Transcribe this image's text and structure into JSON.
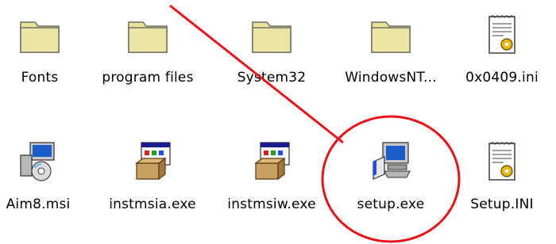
{
  "files": [
    {
      "name": "Fonts",
      "icon": "folder-icon"
    },
    {
      "name": "program files",
      "icon": "folder-icon"
    },
    {
      "name": "System32",
      "icon": "folder-icon"
    },
    {
      "name": "WindowsNT...",
      "icon": "folder-icon"
    },
    {
      "name": "0x0409.ini",
      "icon": "ini-file-icon"
    },
    {
      "name": "Aim8.msi",
      "icon": "msi-installer-icon"
    },
    {
      "name": "instmsia.exe",
      "icon": "installer-exe-icon"
    },
    {
      "name": "instmsiw.exe",
      "icon": "installer-exe-icon"
    },
    {
      "name": "setup.exe",
      "icon": "setup-exe-icon"
    },
    {
      "name": "Setup.INI",
      "icon": "ini-file-icon"
    }
  ],
  "annotation": {
    "color": "#e8141b",
    "target": "setup.exe"
  }
}
